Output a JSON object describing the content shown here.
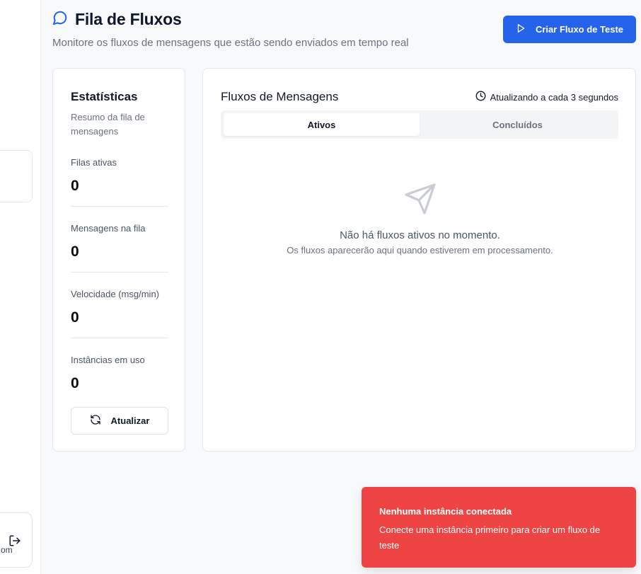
{
  "sidebar": {
    "user_fragment": "om"
  },
  "header": {
    "title": "Fila de Fluxos",
    "subtitle": "Monitore os fluxos de mensagens que estão sendo enviados em tempo real",
    "create_button": "Criar Fluxo de Teste"
  },
  "stats": {
    "title": "Estatísticas",
    "description": "Resumo da fila de mensagens",
    "items": [
      {
        "label": "Filas ativas",
        "value": "0"
      },
      {
        "label": "Mensagens na fila",
        "value": "0"
      },
      {
        "label": "Velocidade (msg/min)",
        "value": "0"
      },
      {
        "label": "Instâncias em uso",
        "value": "0"
      }
    ],
    "refresh_button": "Atualizar"
  },
  "flows": {
    "title": "Fluxos de Mensagens",
    "refresh_note": "Atualizando a cada 3 segundos",
    "tabs": [
      {
        "label": "Ativos"
      },
      {
        "label": "Concluídos"
      }
    ],
    "empty_title": "Não há fluxos ativos no momento.",
    "empty_subtitle": "Os fluxos aparecerão aqui quando estiverem em processamento."
  },
  "toast": {
    "title": "Nenhuma instância conectada",
    "message": "Conecte uma instância primeiro para criar um fluxo de teste"
  },
  "colors": {
    "primary": "#2563eb",
    "danger": "#ef4444"
  }
}
